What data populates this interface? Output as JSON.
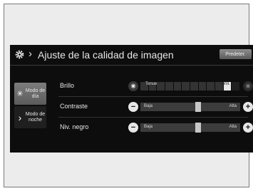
{
  "header": {
    "title": "Ajuste de la calidad de imagen",
    "predet_label": "Predeter."
  },
  "modes": {
    "day_label_1": "Modo de",
    "day_label_2": "día",
    "night_label_1": "Modo de",
    "night_label_2": "noche"
  },
  "rows": {
    "brillo": {
      "label": "Brillo",
      "low": "Tenue",
      "high": "Brill.",
      "level": 0.92
    },
    "contraste": {
      "label": "Contraste",
      "low": "Baja",
      "high": "Alta",
      "level": 0.58
    },
    "negro": {
      "label": "Niv. negro",
      "low": "Baja",
      "high": "Alta",
      "level": 0.58
    }
  }
}
